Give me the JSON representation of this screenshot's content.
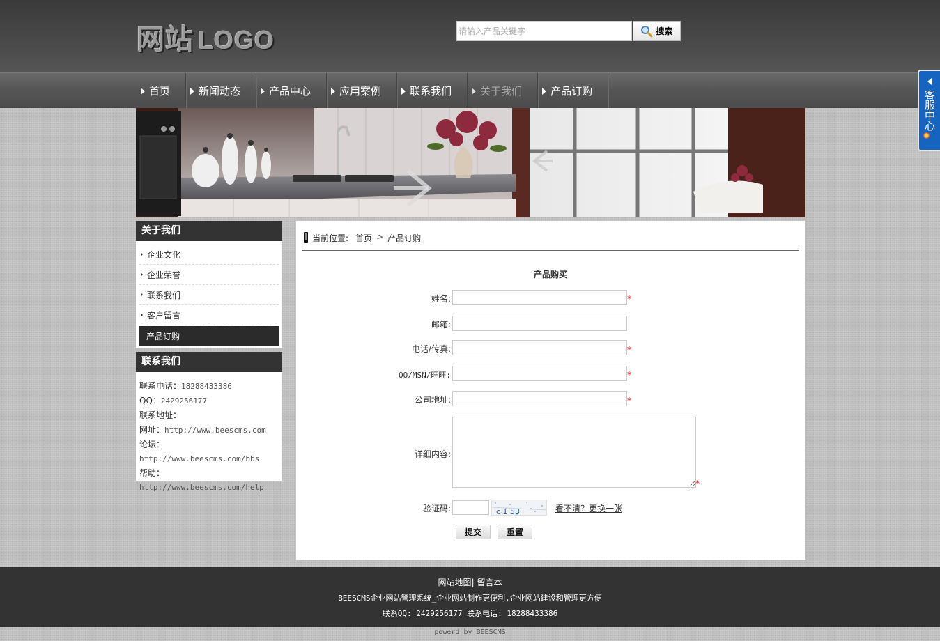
{
  "header": {
    "logo_cn": "网站",
    "logo_en": "LOGO",
    "search_placeholder": "请输入产品关键字",
    "search_button": "搜索"
  },
  "nav": {
    "items": [
      {
        "label": "首页"
      },
      {
        "label": "新闻动态"
      },
      {
        "label": "产品中心"
      },
      {
        "label": "应用案例"
      },
      {
        "label": "联系我们"
      },
      {
        "label": "关于我们"
      },
      {
        "label": "产品订购"
      }
    ]
  },
  "service_tab": {
    "label": "客服中心"
  },
  "sidebar": {
    "title": "关于我们",
    "items": [
      {
        "label": "企业文化"
      },
      {
        "label": "企业荣誉"
      },
      {
        "label": "联系我们"
      },
      {
        "label": "客户留言"
      },
      {
        "label": "产品订购"
      }
    ],
    "contact_title": "联系我们",
    "contact": [
      {
        "label": "联系电话：",
        "value": "18288433386"
      },
      {
        "label": "QQ：",
        "value": "2429256177"
      },
      {
        "label": "联系地址：",
        "value": ""
      },
      {
        "label": "网址：",
        "value": "http://www.beescms.com"
      },
      {
        "label": "论坛：",
        "value": "http://www.beescms.com/bbs"
      },
      {
        "label": "帮助：",
        "value": "http://www.beescms.com/help"
      }
    ]
  },
  "breadcrumb": {
    "prefix": "当前位置:",
    "home": "首页",
    "sep": ">",
    "current": "产品订购"
  },
  "form": {
    "title": "产品购买",
    "name_label": "姓名:",
    "email_label": "邮箱:",
    "phone_label": "电话/传真:",
    "im_label": "QQ/MSN/旺旺:",
    "address_label": "公司地址:",
    "detail_label": "详细内容:",
    "captcha_label": "验证码:",
    "captcha_text": "c 1 53",
    "captcha_refresh": "看不清？更换一张",
    "required_mark": "*",
    "submit": "提交",
    "reset": "重置"
  },
  "footer": {
    "sitemap": "网站地图",
    "divider": "|",
    "guestbook": "留言本",
    "slogan": "BEESCMS企业网站管理系统_企业网站制作更便利,企业网站建设和管理更方便",
    "contact": "联系QQ: 2429256177 联系电话: 18288433386",
    "powered": "powerd by BEESCMS"
  }
}
